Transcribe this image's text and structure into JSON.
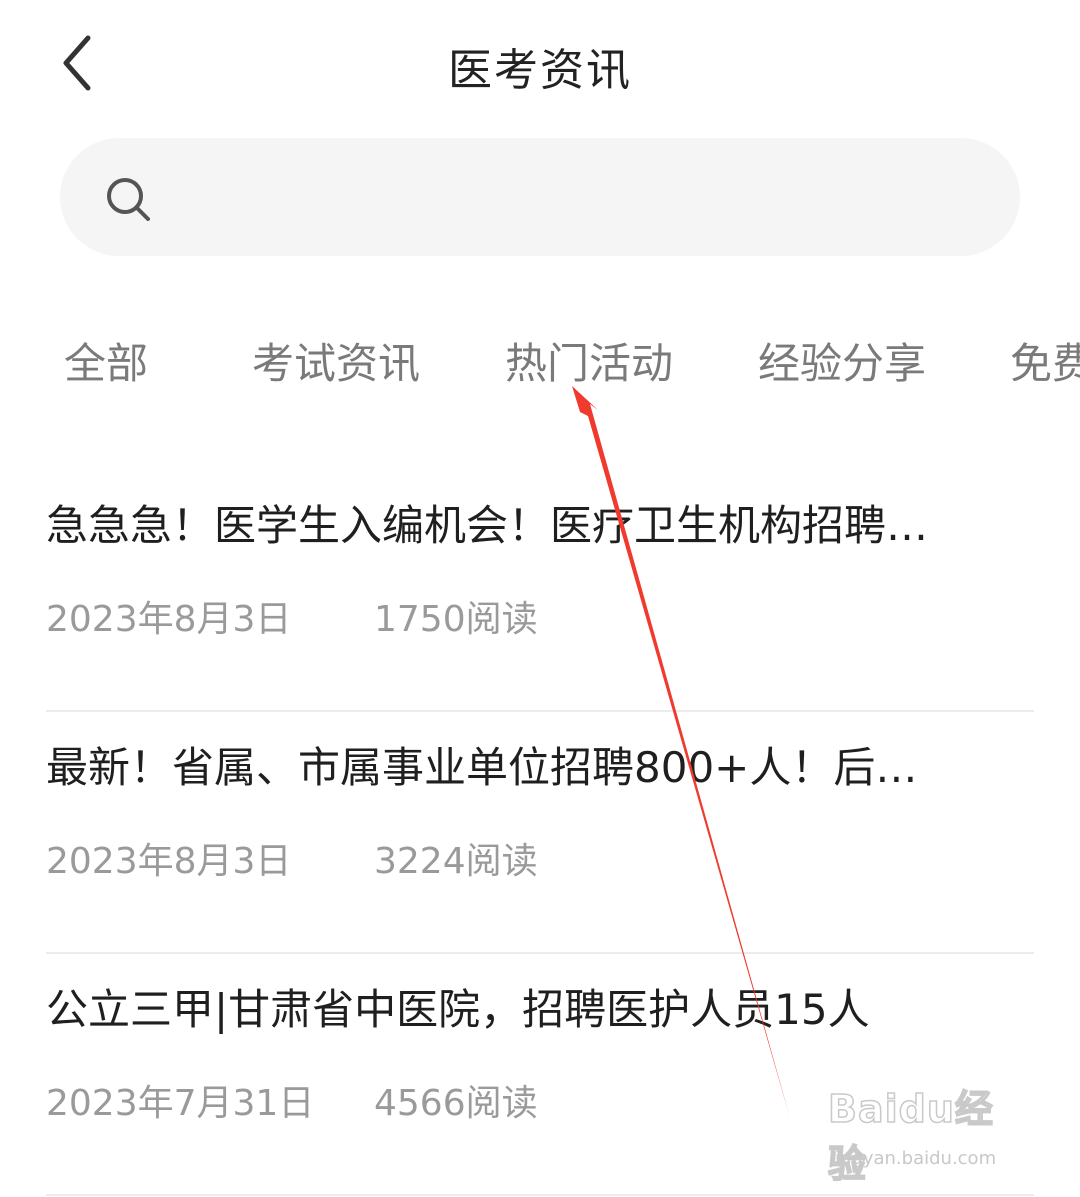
{
  "header": {
    "title": "医考资讯",
    "back_icon": "chevron-left-icon"
  },
  "search": {
    "icon": "search-icon",
    "value": "",
    "placeholder": ""
  },
  "tabs": [
    {
      "label": "全部"
    },
    {
      "label": "考试资讯"
    },
    {
      "label": "热门活动"
    },
    {
      "label": "经验分享"
    },
    {
      "label": "免费"
    }
  ],
  "news": [
    {
      "title": "急急急！医学生入编机会！医疗卫生机构招聘…",
      "date": "2023年8月3日",
      "reads": "1750阅读"
    },
    {
      "title": "最新！省属、市属事业单位招聘800+人！后…",
      "date": "2023年8月3日",
      "reads": "3224阅读"
    },
    {
      "title": "公立三甲|甘肃省中医院，招聘医护人员15人",
      "date": "2023年7月31日",
      "reads": "4566阅读"
    }
  ],
  "annotation": {
    "color": "#f03a2e"
  },
  "watermark": {
    "brand": "Baidu经验",
    "url": "jingyan.baidu.com"
  }
}
